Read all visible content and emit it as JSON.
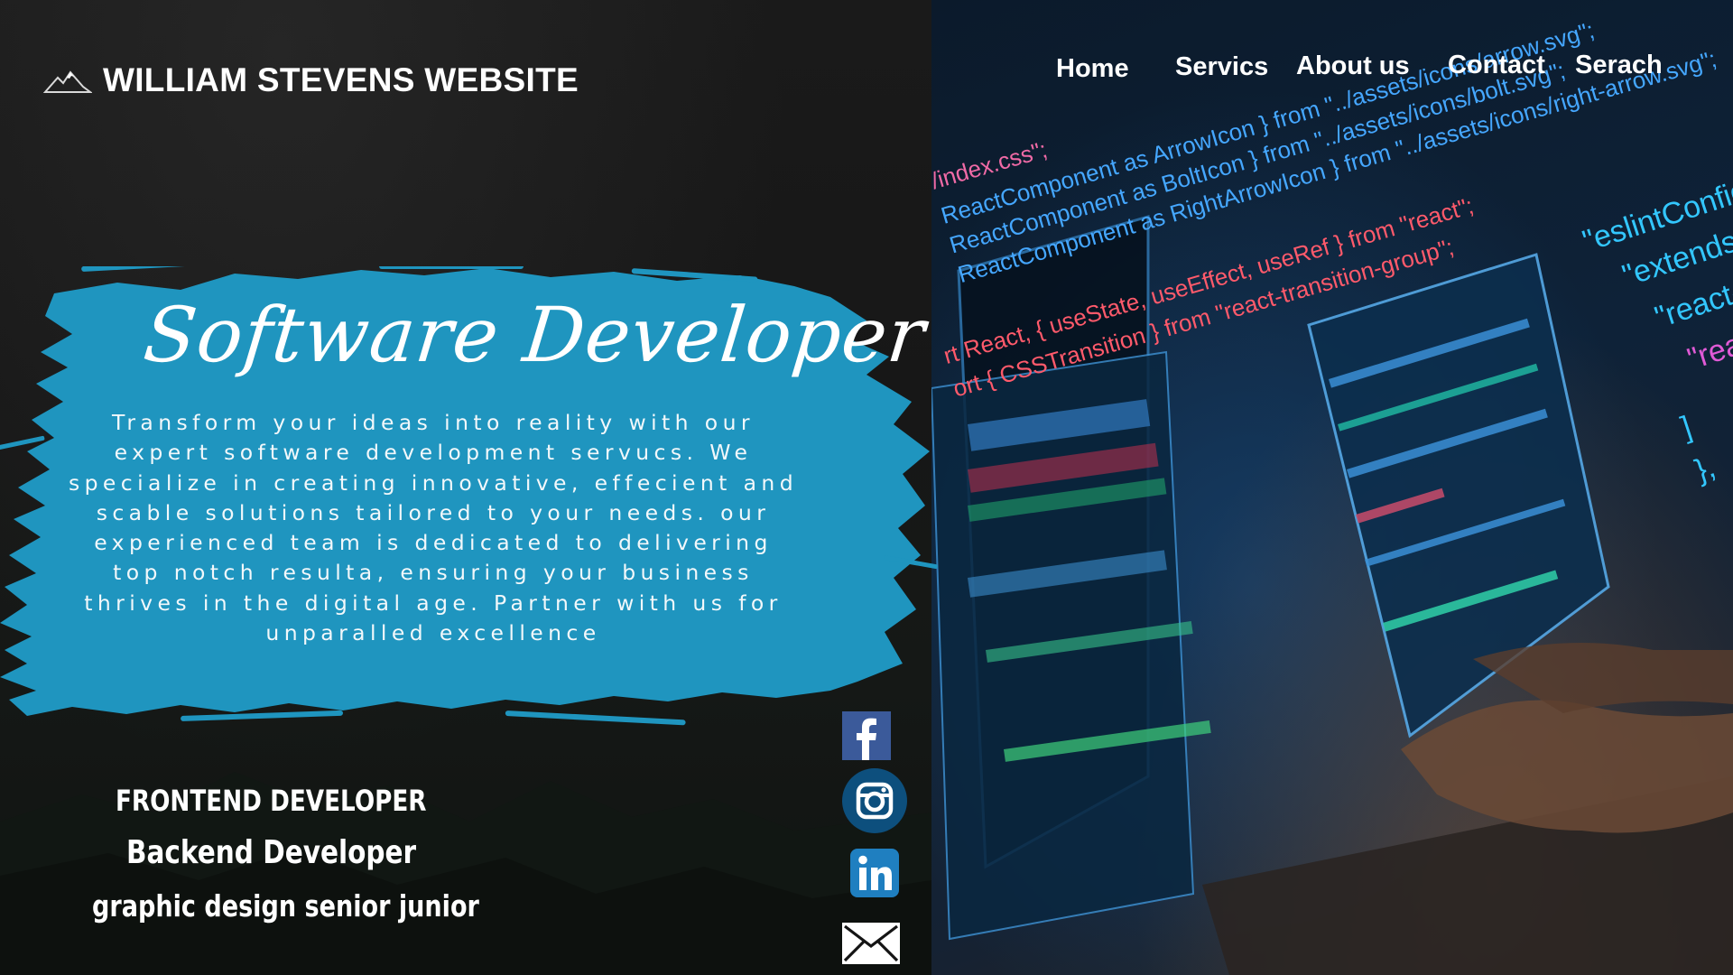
{
  "brand": {
    "title": "WILLIAM STEVENS WEBSITE",
    "logo_icon": "mountain-logo-icon"
  },
  "nav": {
    "items": [
      {
        "label": "Home"
      },
      {
        "label": "Servics"
      },
      {
        "label": "About us"
      },
      {
        "label": "Contact"
      },
      {
        "label": "Serach"
      }
    ]
  },
  "hero": {
    "title": "Software Developer",
    "lines": [
      "Transform your ideas into reality with our",
      "expert software development servucs. We",
      "specialize in creating innovative, effecient and",
      "scable solutions tailored to your needs. our",
      "experienced team is dedicated to delivering",
      "top notch resulta, ensuring your business",
      "thrives in the digital age. Partner with us for",
      "unparalled excellence"
    ]
  },
  "roles": [
    "FRONTEND DEVELOPER",
    "Backend Developer",
    "graphic design senior junior"
  ],
  "social": [
    {
      "icon": "facebook-icon"
    },
    {
      "icon": "instagram-icon"
    },
    {
      "icon": "linkedin-icon"
    },
    {
      "icon": "mail-icon"
    }
  ],
  "colors": {
    "brush": "#1f95bf",
    "background": "#141414",
    "text": "#ffffff"
  },
  "photo": {
    "code_lines": [
      "/index.css\";",
      "ReactComponent as ArrowIcon } from \"../assets/icons/arrow.svg\";",
      "ReactComponent as BoltIcon } from \"../assets/icons/bolt.svg\";",
      "ReactComponent as RightArrowIcon } from \"../assets/icons/right-arrow.svg\";",
      "rt React, { useState, useEffect, useRef } from \"react\";",
      "ort { CSSTransition } from \"react-transition-group\";"
    ],
    "config_lines": [
      "\"eslintConfig\"",
      "\"extends\"",
      "\"react-a",
      "\"react-",
      "]",
      "},"
    ]
  }
}
